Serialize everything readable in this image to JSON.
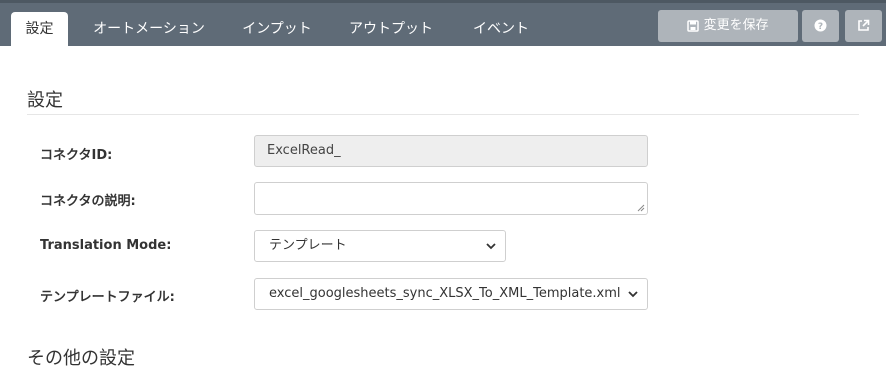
{
  "tabs": [
    {
      "label": "設定",
      "active": true
    },
    {
      "label": "オートメーション"
    },
    {
      "label": "インプット"
    },
    {
      "label": "アウトプット"
    },
    {
      "label": "イベント"
    }
  ],
  "toolbar": {
    "save_label": "変更を保存",
    "help_icon": "question-circle-icon",
    "external_icon": "external-link-icon"
  },
  "section": {
    "title": "設定",
    "next_title": "その他の設定"
  },
  "form": {
    "connector_id": {
      "label": "コネクタID:",
      "value": "ExcelRead_"
    },
    "description": {
      "label": "コネクタの説明:",
      "value": ""
    },
    "translation_mode": {
      "label": "Translation Mode:",
      "value": "テンプレート"
    },
    "template_file": {
      "label": "テンプレートファイル:",
      "value": "excel_googlesheets_sync_XLSX_To_XML_Template.xml"
    }
  },
  "colors": {
    "topbar": "#5f6b77",
    "toolbar_button": "#aeb4ba",
    "readonly_field": "#eeeeee"
  }
}
